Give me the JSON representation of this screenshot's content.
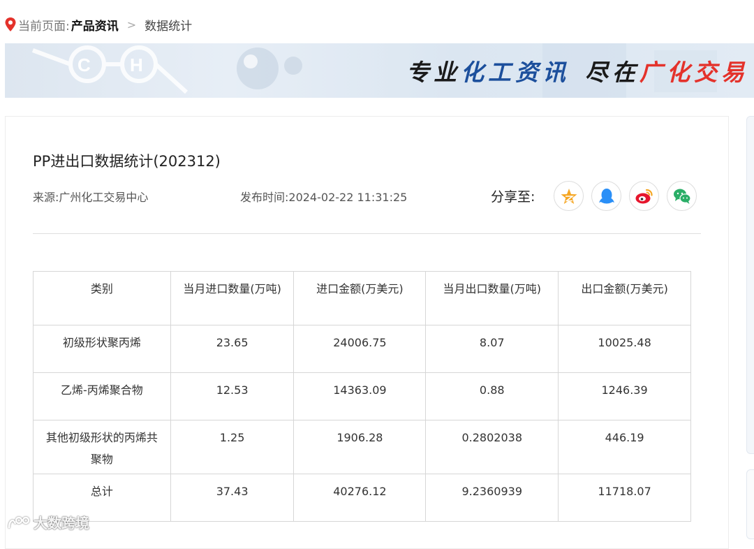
{
  "breadcrumb": {
    "current_label": "当前页面:",
    "section": "产品资讯",
    "separator": ">",
    "page": "数据统计"
  },
  "banner": {
    "part1": "专业",
    "part2": "化工资讯",
    "part3": "尽在",
    "part4": "广化交易"
  },
  "article": {
    "title": "PP进出口数据统计(202312)",
    "source": "来源:广州化工交易中心",
    "publish_time": "发布时间:2024-02-22 11:31:25"
  },
  "share": {
    "label": "分享至:",
    "buttons": [
      {
        "icon": "qzone-star-icon",
        "color": "#f5a623"
      },
      {
        "icon": "qq-penguin-icon",
        "color": "#2a8ff7"
      },
      {
        "icon": "weibo-icon",
        "color": "#e6162d"
      },
      {
        "icon": "wechat-icon",
        "color": "#2aae67"
      }
    ]
  },
  "table": {
    "headers": [
      "类别",
      "当月进口数量(万吨)",
      "进口金额(万美元)",
      "当月出口数量(万吨)",
      "出口金额(万美元)"
    ],
    "rows": [
      [
        "初级形状聚丙烯",
        "23.65",
        "24006.75",
        "8.07",
        "10025.48"
      ],
      [
        "乙烯-丙烯聚合物",
        "12.53",
        "14363.09",
        "0.88",
        "1246.39"
      ],
      [
        "其他初级形状的丙烯共聚物",
        "1.25",
        "1906.28",
        "0.2802038",
        "446.19"
      ],
      [
        "总计",
        "37.43",
        "40276.12",
        "9.2360939",
        "11718.07"
      ]
    ]
  },
  "watermark": {
    "text": "大数跨境"
  }
}
